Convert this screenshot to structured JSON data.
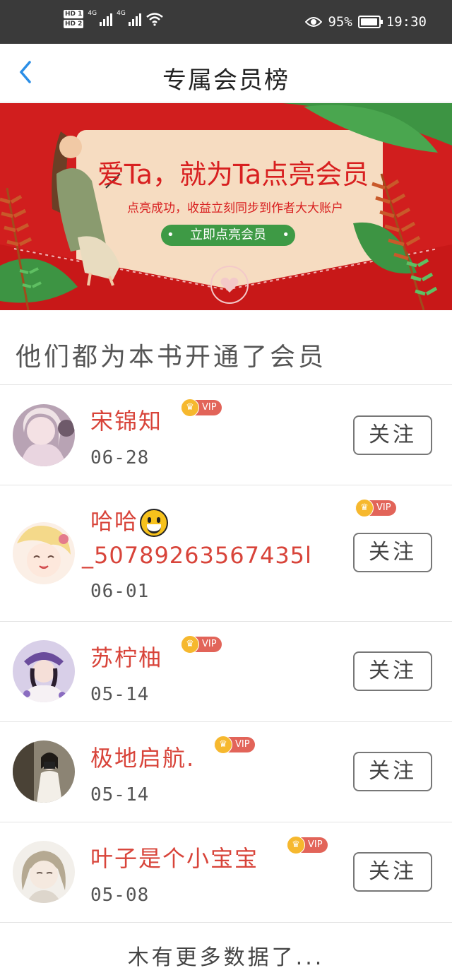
{
  "status_bar": {
    "hd1": "HD 1",
    "hd2": "HD 2",
    "net1": "4G",
    "net2": "4G",
    "battery_pct": "95%",
    "time": "19:30"
  },
  "nav": {
    "title": "专属会员榜"
  },
  "banner": {
    "headline": "爱Ta，就为Ta点亮会员",
    "subtitle": "点亮成功，收益立刻同步到作者大大账户",
    "button_label": "立即点亮会员"
  },
  "section": {
    "title": "他们都为本书开通了会员"
  },
  "members": [
    {
      "name": "宋锦知",
      "date": "06-28",
      "badge": "VIP",
      "follow_label": "关注"
    },
    {
      "name": "哈哈",
      "name_line2": "_50789263567435l",
      "date": "06-01",
      "badge": "VIP",
      "follow_label": "关注"
    },
    {
      "name": "苏柠柚",
      "date": "05-14",
      "badge": "VIP",
      "follow_label": "关注"
    },
    {
      "name": "极地启航.",
      "date": "05-14",
      "badge": "VIP",
      "follow_label": "关注"
    },
    {
      "name": "叶子是个小宝宝",
      "date": "05-08",
      "badge": "VIP",
      "follow_label": "关注"
    }
  ],
  "footer": {
    "text": "木有更多数据了..."
  },
  "colors": {
    "accent_red": "#d8443a",
    "banner_red": "#d11e1e",
    "vip_red": "#e26459",
    "crown_gold": "#f6b82e",
    "banner_green": "#3e9a45"
  },
  "icons": [
    "hd-icon",
    "signal-icon",
    "wifi-icon",
    "eye-icon",
    "battery-icon",
    "back-chevron-icon",
    "crown-icon",
    "smiley-emoji-icon"
  ]
}
